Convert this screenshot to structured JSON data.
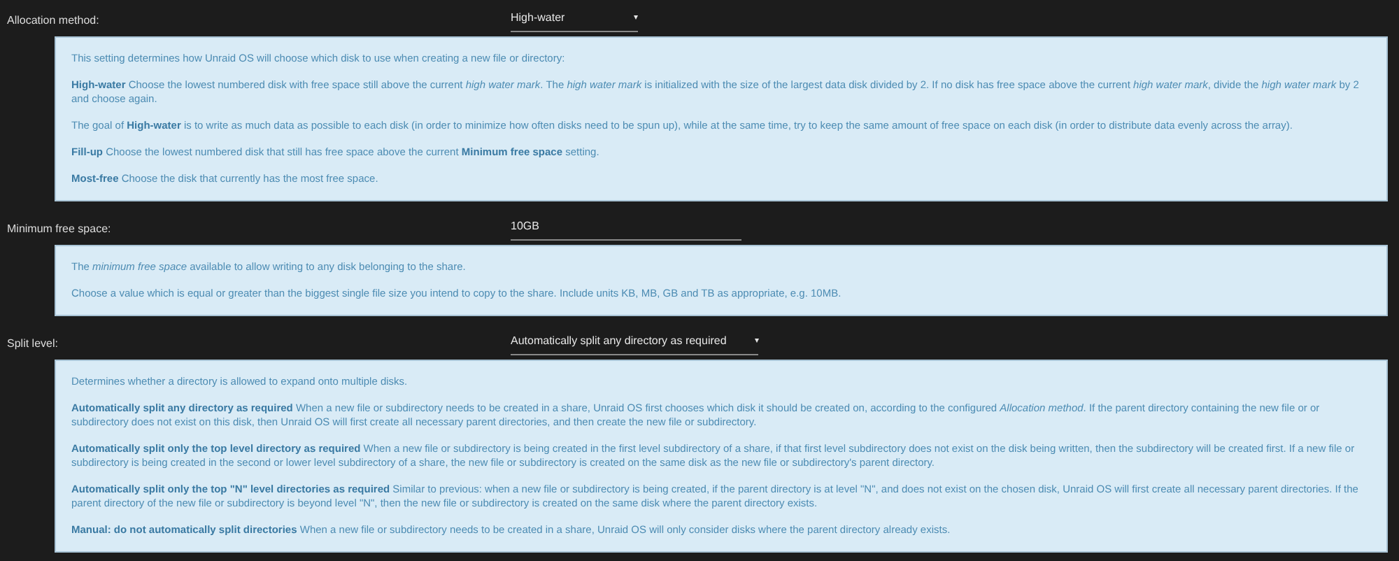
{
  "settings": [
    {
      "label": "Allocation method:",
      "control": {
        "kind": "select",
        "value": "High-water",
        "caret": "▾"
      },
      "help": [
        "This setting determines how Unraid OS will choose which disk to use when creating a new file or directory:",
        "**High-water** Choose the lowest numbered disk with free space still above the current *high water mark*. The *high water mark* is initialized with the size of the largest data disk divided by 2. If no disk has free space above the current *high water mark*, divide the *high water mark* by 2 and choose again.",
        "The goal of **High-water** is to write as much data as possible to each disk (in order to minimize how often disks need to be spun up), while at the same time, try to keep the same amount of free space on each disk (in order to distribute data evenly across the array).",
        "**Fill-up** Choose the lowest numbered disk that still has free space above the current **Minimum free space** setting.",
        "**Most-free** Choose the disk that currently has the most free space."
      ]
    },
    {
      "label": "Minimum free space:",
      "control": {
        "kind": "input",
        "value": "10GB"
      },
      "help": [
        "The *minimum free space* available to allow writing to any disk belonging to the share.",
        "Choose a value which is equal or greater than the biggest single file size you intend to copy to the share. Include units KB, MB, GB and TB as appropriate, e.g. 10MB."
      ]
    },
    {
      "label": "Split level:",
      "control": {
        "kind": "select",
        "value": "Automatically split any directory as required",
        "caret": "▾"
      },
      "help": [
        "Determines whether a directory is allowed to expand onto multiple disks.",
        "**Automatically split any directory as required** When a new file or subdirectory needs to be created in a share, Unraid OS first chooses which disk it should be created on, according to the configured *Allocation method*. If the parent directory containing the new file or or subdirectory does not exist on this disk, then Unraid OS will first create all necessary parent directories, and then create the new file or subdirectory.",
        "**Automatically split only the top level directory as required** When a new file or subdirectory is being created in the first level subdirectory of a share, if that first level subdirectory does not exist on the disk being written, then the subdirectory will be created first. If a new file or subdirectory is being created in the second or lower level subdirectory of a share, the new file or subdirectory is created on the same disk as the new file or subdirectory's parent directory.",
        "**Automatically split only the top \"N\" level directories as required** Similar to previous: when a new file or subdirectory is being created, if the parent directory is at level \"N\", and does not exist on the chosen disk, Unraid OS will first create all necessary parent directories. If the parent directory of the new file or subdirectory is beyond level \"N\", then the new file or subdirectory is created on the same disk where the parent directory exists.",
        "**Manual: do not automatically split directories** When a new file or subdirectory needs to be created in a share, Unraid OS will only consider disks where the parent directory already exists."
      ]
    }
  ]
}
